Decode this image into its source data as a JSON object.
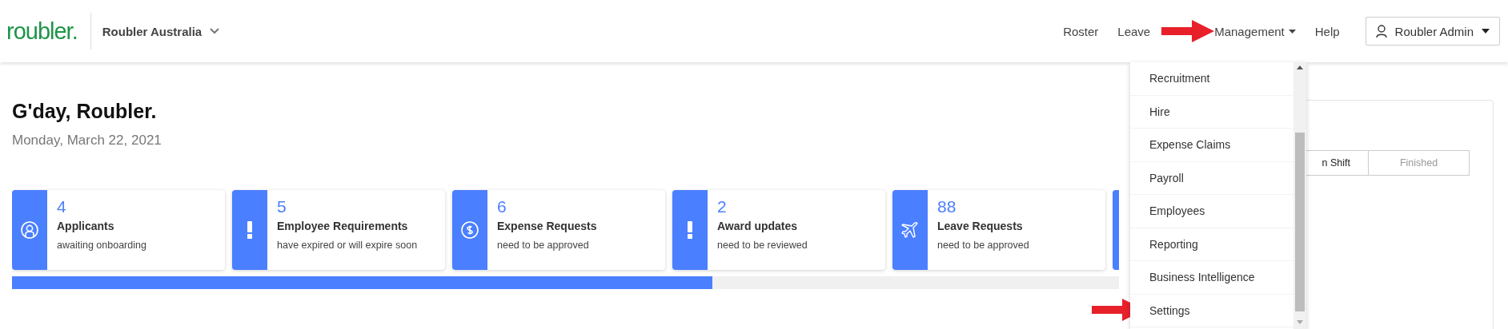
{
  "header": {
    "logo": "roubler.",
    "company": "Roubler Australia",
    "nav": [
      {
        "label": "Roster",
        "open": false
      },
      {
        "label": "Leave",
        "open": false
      },
      {
        "label": "Management",
        "open": true
      },
      {
        "label": "Help",
        "open": false
      }
    ],
    "user": "Roubler Admin"
  },
  "greeting": {
    "title": "G'day, Roubler.",
    "date": "Monday, March 22, 2021"
  },
  "cards": [
    {
      "kind": "applicants",
      "count": "4",
      "title": "Applicants",
      "subtitle": "awaiting onboarding"
    },
    {
      "kind": "requirements",
      "count": "5",
      "title": "Employee Requirements",
      "subtitle": "have expired or will expire soon"
    },
    {
      "kind": "expenses",
      "count": "6",
      "title": "Expense Requests",
      "subtitle": "need to be approved"
    },
    {
      "kind": "awards",
      "count": "2",
      "title": "Award updates",
      "subtitle": "need to be reviewed"
    },
    {
      "kind": "leave",
      "count": "88",
      "title": "Leave Requests",
      "subtitle": "need to be approved"
    }
  ],
  "progress": {
    "level": 0.633
  },
  "shift_tabs": [
    {
      "label": "n Shift",
      "selected": true
    },
    {
      "label": "Finished",
      "selected": false
    }
  ],
  "management_menu": {
    "items": [
      {
        "label": "Recruitment"
      },
      {
        "label": "Hire"
      },
      {
        "label": "Expense Claims"
      },
      {
        "label": "Payroll"
      },
      {
        "label": "Employees"
      },
      {
        "label": "Reporting"
      },
      {
        "label": "Business Intelligence"
      },
      {
        "label": "Settings"
      }
    ]
  }
}
